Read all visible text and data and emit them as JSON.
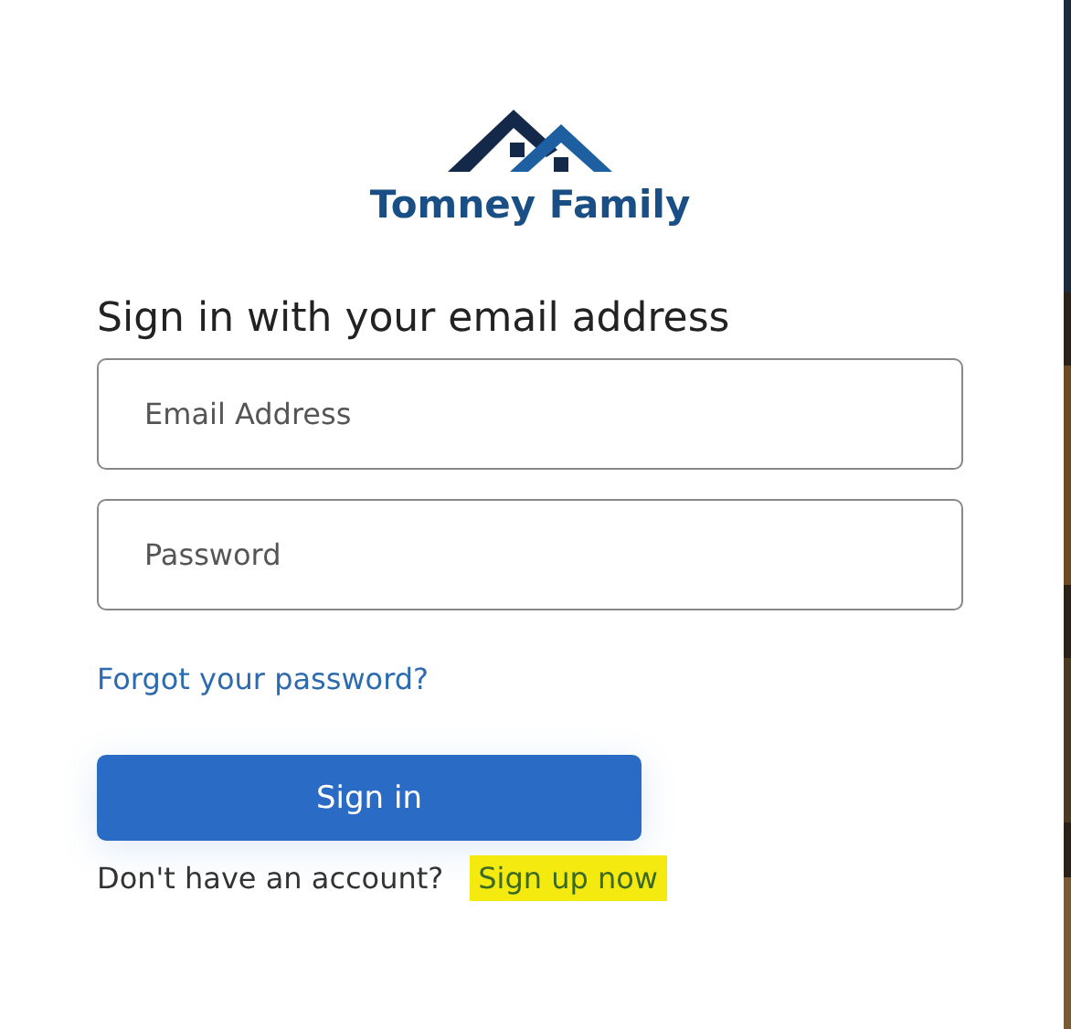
{
  "logo": {
    "name": "Tomney Family"
  },
  "heading": "Sign in with your email address",
  "fields": [
    {
      "placeholder": "Email Address"
    },
    {
      "placeholder": "Password"
    }
  ],
  "forgot_link": "Forgot your password?",
  "submit_button": "Sign in",
  "signup": {
    "prompt": "Don't have an account?",
    "link": "Sign up now",
    "highlighted": true
  }
}
